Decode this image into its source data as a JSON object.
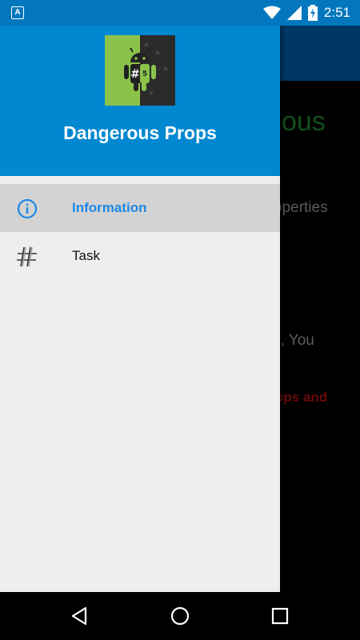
{
  "status_bar": {
    "notification_icon": "A",
    "time": "2:51",
    "icons": [
      "wifi-icon",
      "signal-icon",
      "battery-charging-icon"
    ]
  },
  "background": {
    "title_fragment": "ous",
    "line1_fragment": "operties",
    "line2_fragment": "e, You",
    "line3_fragment": "ops and",
    "colors": {
      "title": "#1B7A2E",
      "warning": "#A01010",
      "appbar": "#01579B"
    }
  },
  "drawer": {
    "header_color": "#0288D1",
    "title": "Dangerous Props",
    "logo_text": "#",
    "logo_badge": "5",
    "menu": [
      {
        "label": "Information",
        "icon": "info-icon",
        "active": true
      },
      {
        "label": "Task",
        "icon": "hash-icon",
        "active": false
      }
    ]
  },
  "nav_bar": {
    "buttons": [
      "back-icon",
      "home-icon",
      "recents-icon"
    ]
  }
}
